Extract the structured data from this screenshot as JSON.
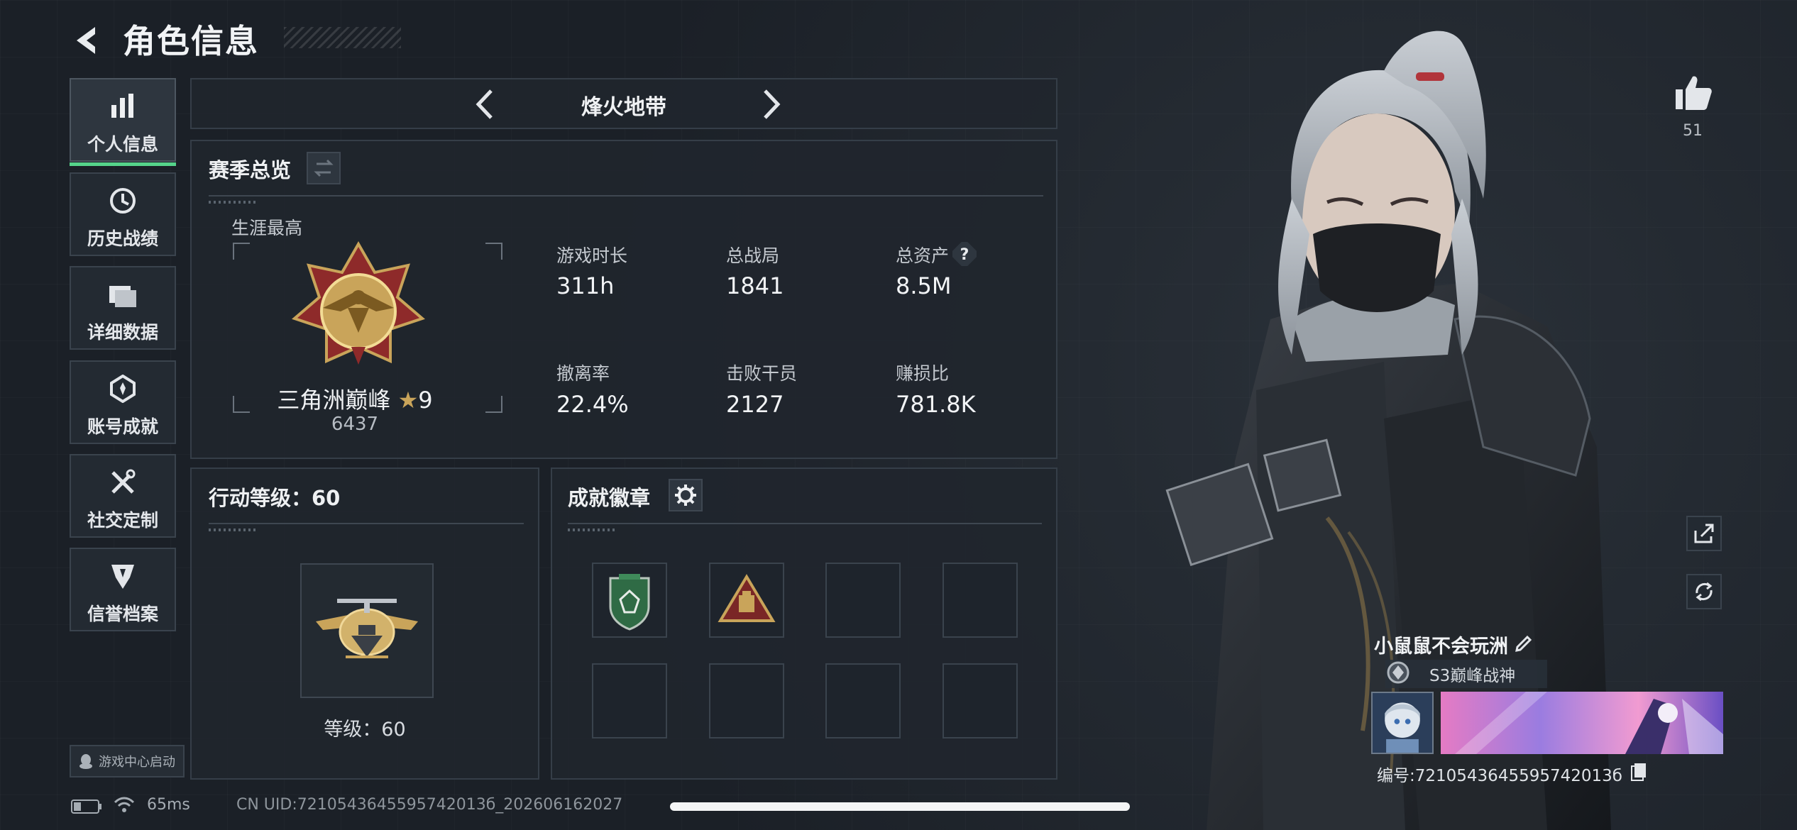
{
  "header": {
    "title": "角色信息"
  },
  "sidebar": {
    "items": [
      {
        "label": "个人信息",
        "icon": "bar-chart-icon",
        "active": true
      },
      {
        "label": "历史战绩",
        "icon": "clock-icon",
        "active": false
      },
      {
        "label": "详细数据",
        "icon": "folder-icon",
        "active": false
      },
      {
        "label": "账号成就",
        "icon": "achievement-icon",
        "active": false
      },
      {
        "label": "社交定制",
        "icon": "tools-icon",
        "active": false
      },
      {
        "label": "信誉档案",
        "icon": "credit-icon",
        "active": false
      }
    ],
    "game_center": "游戏中心启动"
  },
  "mode": {
    "label": "烽火地带"
  },
  "season": {
    "title": "赛季总览",
    "career_label": "生涯最高",
    "rank_name": "三角洲巅峰",
    "rank_stars": "9",
    "rank_score": "6437",
    "stats": [
      {
        "label": "游戏时长",
        "value": "311h"
      },
      {
        "label": "总战局",
        "value": "1841"
      },
      {
        "label": "总资产",
        "value": "8.5M"
      },
      {
        "label": "撤离率",
        "value": "22.4%"
      },
      {
        "label": "击败干员",
        "value": "2127"
      },
      {
        "label": "赚损比",
        "value": "781.8K"
      }
    ]
  },
  "operation": {
    "title": "行动等级：60",
    "level_label": "等级：60"
  },
  "badges": {
    "title": "成就徽章",
    "slots": 8,
    "filled": [
      "shield-badge",
      "triangle-badge"
    ]
  },
  "profile": {
    "likes": "51",
    "player_name": "小鼠鼠不会玩洲",
    "title_badge": "S3巅峰战神",
    "player_id": "编号:7210543645595742013б"
  },
  "status": {
    "ping": "65ms",
    "uid": "CN UID:7210543645595742013б_202606162027"
  },
  "colors": {
    "active_tab": "#55d38a",
    "gold": "#c9a45a",
    "background": "#1b2027"
  }
}
